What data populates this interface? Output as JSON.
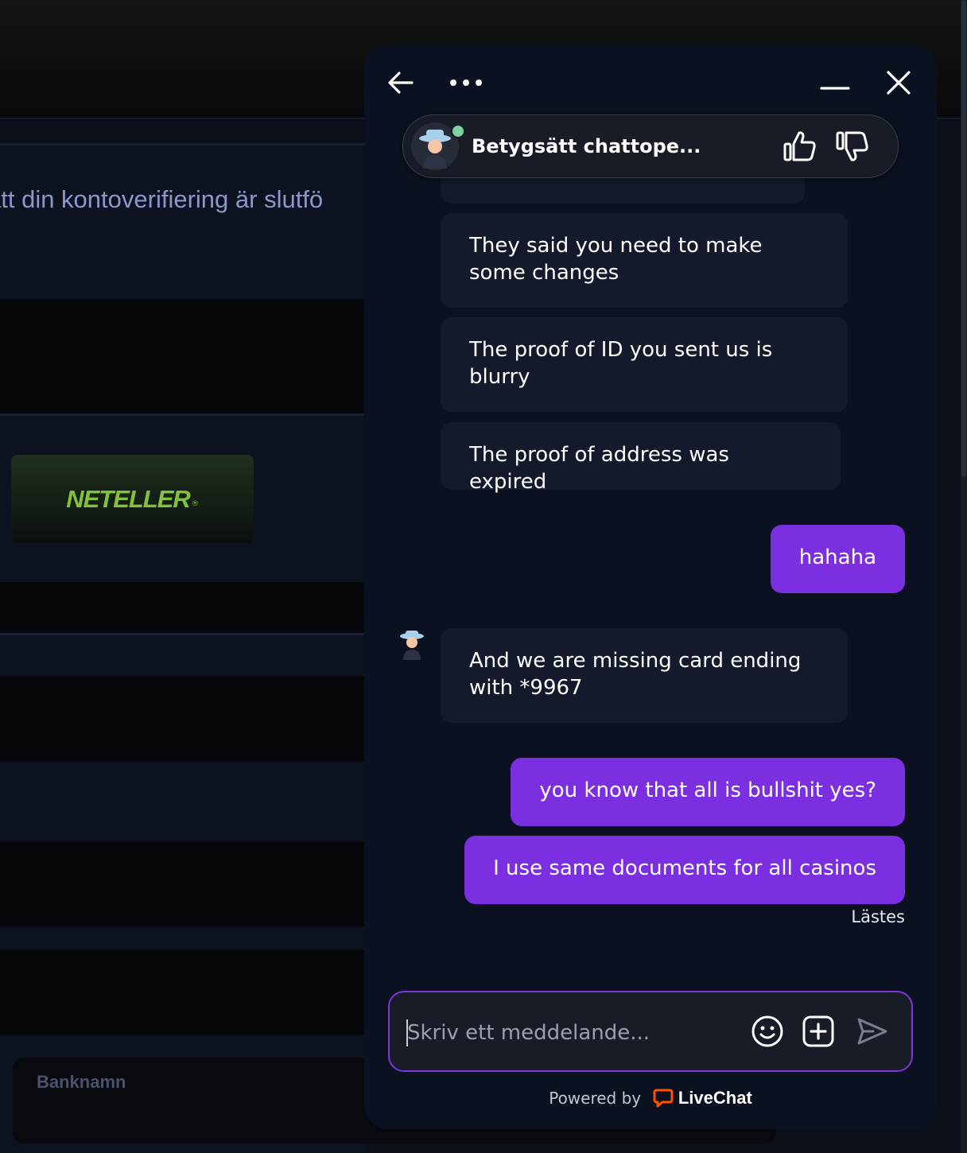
{
  "background": {
    "header_text": "att din kontoverifiering är slutfö",
    "payment_logo": "NETELLER",
    "payment_logo_mark": "®",
    "bank_label": "Banknamn"
  },
  "chat": {
    "header": {
      "back_icon": "arrow-left-icon",
      "menu_icon": "more-dots-icon",
      "minimize_icon": "minimize-icon",
      "close_icon": "close-icon"
    },
    "rating": {
      "title": "Betygsätt chattope...",
      "thumbs_up_icon": "thumbs-up-icon",
      "thumbs_down_icon": "thumbs-down-icon",
      "status_color": "#7dd39b"
    },
    "messages": [
      {
        "from": "agent",
        "text": "They said you need to make some changes"
      },
      {
        "from": "agent",
        "text": "The proof of ID you sent us is blurry"
      },
      {
        "from": "agent",
        "text": "The proof of address was expired"
      },
      {
        "from": "user",
        "text": "hahaha"
      },
      {
        "from": "agent",
        "text": "And we are missing card ending with *9967"
      },
      {
        "from": "user",
        "text": "you know that all is bullshit yes?"
      },
      {
        "from": "user",
        "text": "I use same documents for all casinos"
      }
    ],
    "read_status": "Lästes",
    "composer": {
      "placeholder": "Skriv ett meddelande...",
      "value": ""
    },
    "footer": {
      "powered_by": "Powered by",
      "brand": "LiveChat"
    },
    "colors": {
      "user_bubble": "#7b2fe0",
      "agent_bubble": "#141a2b",
      "panel": "#0b1120",
      "brand_accent": "#ff5100"
    }
  }
}
